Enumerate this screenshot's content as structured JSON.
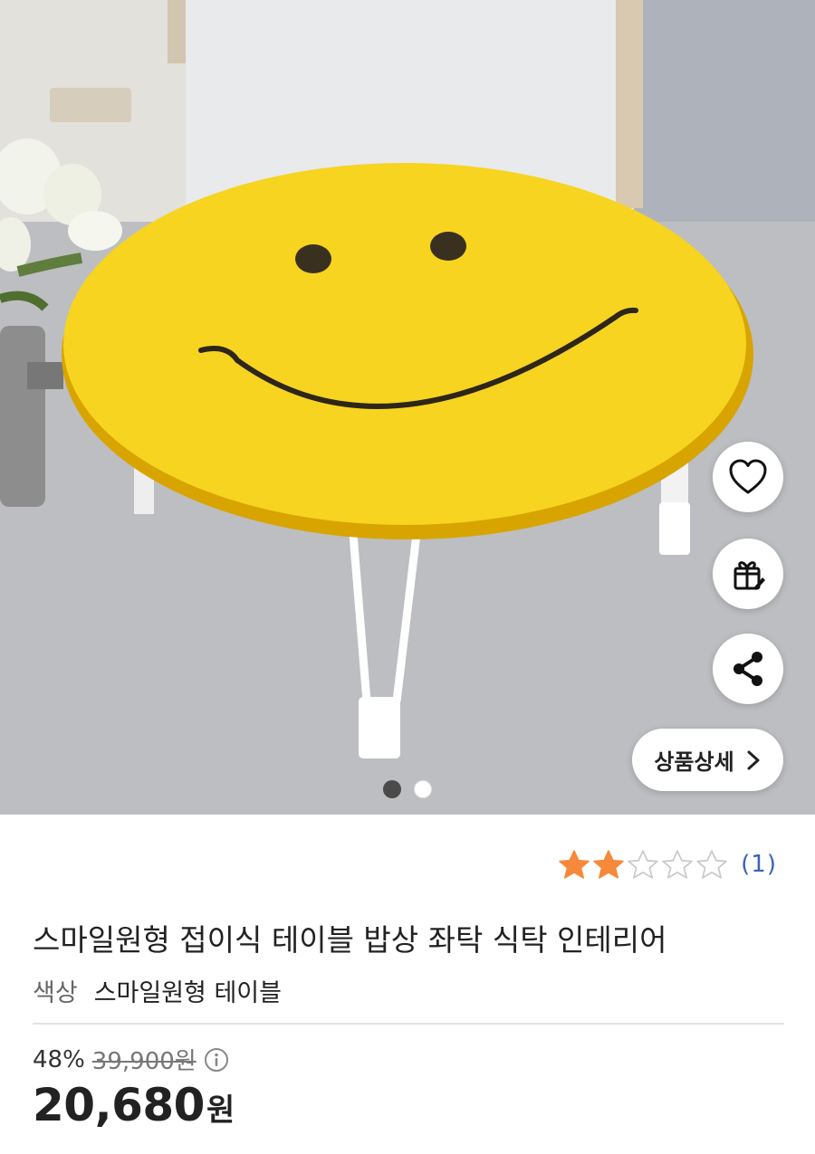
{
  "product": {
    "title": "스마일원형 접이식 테이블 밥상 좌탁 식탁 인테리어",
    "option_key": "색상",
    "option_value": "스마일원형 테이블"
  },
  "rating": {
    "filled_stars": 2,
    "total_stars": 5,
    "review_count": "(1)",
    "star_color": "#f7893a"
  },
  "price": {
    "discount_rate": "48%",
    "original_price": "39,900원",
    "sale_amount": "20,680",
    "sale_unit": "원"
  },
  "gallery": {
    "detail_button_label": "상품상세",
    "image_count": 2,
    "active_index": 0
  },
  "actions": {
    "wishlist_icon": "heart-icon",
    "gift_icon": "gift-icon",
    "share_icon": "share-icon"
  }
}
